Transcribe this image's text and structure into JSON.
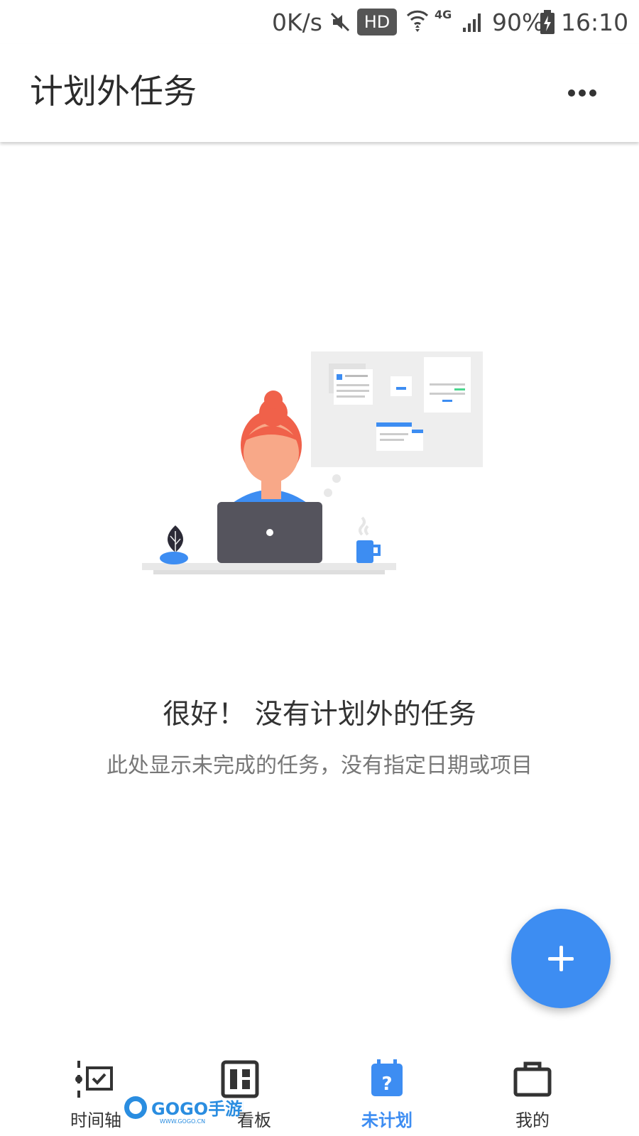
{
  "status_bar": {
    "net_speed": "0K/s",
    "hd_badge": "HD",
    "network_type": "4G",
    "battery_percent": "90%",
    "time": "16:10",
    "icons": [
      "mute-icon",
      "wifi-icon",
      "signal-icon",
      "battery-charging-icon"
    ]
  },
  "app_bar": {
    "title": "计划外任务",
    "more_icon": "more-horizontal-icon"
  },
  "empty_state": {
    "title": "很好！ 没有计划外的任务",
    "subtitle": "此处显示未完成的任务，没有指定日期或项目"
  },
  "fab": {
    "icon": "plus-icon"
  },
  "bottom_nav": {
    "items": [
      {
        "label": "时间轴",
        "icon": "timeline-icon",
        "active": false
      },
      {
        "label": "看板",
        "icon": "kanban-icon",
        "active": false
      },
      {
        "label": "未计划",
        "icon": "calendar-question-icon",
        "active": true
      },
      {
        "label": "我的",
        "icon": "briefcase-icon",
        "active": false
      }
    ]
  },
  "watermark": {
    "text": "GOGO手游网",
    "url_text": "WWW.GOGO.CN"
  },
  "colors": {
    "accent": "#3d8df2",
    "hair": "#f0614a",
    "skin": "#f8a888",
    "laptop": "#55545d"
  }
}
